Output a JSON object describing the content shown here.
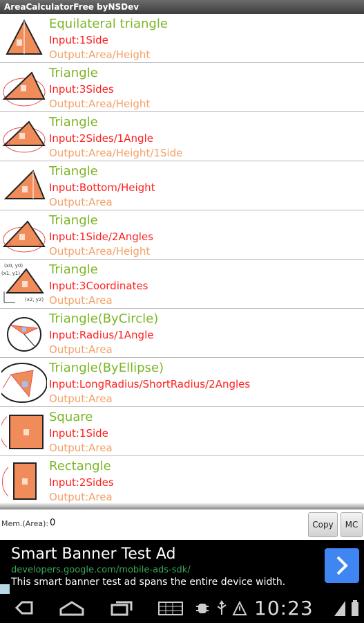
{
  "app": {
    "title": "AreaCalculatorFree byNSDev"
  },
  "items": [
    {
      "name": "Equilateral triangle",
      "input": "Input:1Side",
      "output": "Output:Area/Height",
      "icon": "equilateral-triangle-icon"
    },
    {
      "name": "Triangle",
      "input": "Input:3Sides",
      "output": "Output:Area/Height",
      "icon": "triangle-3sides-icon"
    },
    {
      "name": "Triangle",
      "input": "Input:2Sides/1Angle",
      "output": "Output:Area/Height/1Side",
      "icon": "triangle-2sides-angle-icon"
    },
    {
      "name": "Triangle",
      "input": "Input:Bottom/Height",
      "output": "Output:Area",
      "icon": "triangle-base-height-icon"
    },
    {
      "name": "Triangle",
      "input": "Input:1Side/2Angles",
      "output": "Output:Area/Height",
      "icon": "triangle-side-2angles-icon"
    },
    {
      "name": "Triangle",
      "input": "Input:3Coordinates",
      "output": "Output:Area",
      "icon": "triangle-coordinates-icon",
      "coord_labels": [
        "(x0, y0)",
        "(x1, y1)",
        "(x2, y2)"
      ]
    },
    {
      "name": "Triangle(ByCircle)",
      "input": "Input:Radius/1Angle",
      "output": "Output:Area",
      "icon": "triangle-in-circle-icon"
    },
    {
      "name": "Triangle(ByEllipse)",
      "input": "Input:LongRadius/ShortRadius/2Angles",
      "output": "Output:Area",
      "icon": "triangle-in-ellipse-icon"
    },
    {
      "name": "Square",
      "input": "Input:1Side",
      "output": "Output:Area",
      "icon": "square-icon"
    },
    {
      "name": "Rectangle",
      "input": "Input:2Sides",
      "output": "Output:Area",
      "icon": "rectangle-icon"
    }
  ],
  "memory": {
    "label": "Mem.(Area):",
    "value": "0",
    "copy_label": "Copy",
    "mc_label": "MC"
  },
  "ad": {
    "title": "Smart Banner Test Ad",
    "url": "developers.google.com/mobile-ads-sdk/",
    "description": "This smart banner test ad spans the entire device width.",
    "arrow_icon": "chevron-right-icon"
  },
  "statusbar": {
    "time": "10:23"
  },
  "colors": {
    "title": "#7cb626",
    "input": "#ff2020",
    "output": "#f4a066",
    "shape_fill": "#f08c5a",
    "ad_button": "#3f86f2"
  }
}
